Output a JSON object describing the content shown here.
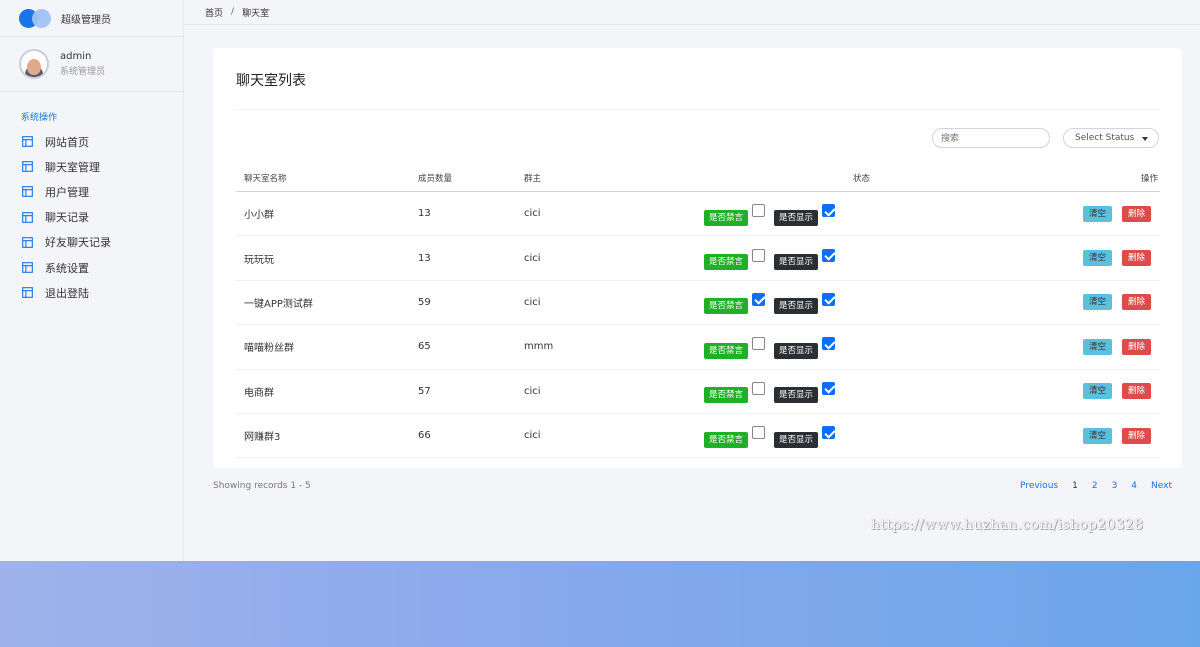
{
  "brand": {
    "title": "超级管理员"
  },
  "user": {
    "name": "admin",
    "role": "系统管理员"
  },
  "sidebar": {
    "section_title": "系统操作",
    "items": [
      {
        "label": "网站首页",
        "icon": "layout-icon"
      },
      {
        "label": "聊天室管理",
        "icon": "layout-icon"
      },
      {
        "label": "用户管理",
        "icon": "layout-icon"
      },
      {
        "label": "聊天记录",
        "icon": "layout-icon"
      },
      {
        "label": "好友聊天记录",
        "icon": "layout-icon"
      },
      {
        "label": "系统设置",
        "icon": "layout-icon"
      },
      {
        "label": "退出登陆",
        "icon": "layout-icon"
      }
    ]
  },
  "breadcrumb": {
    "home": "首页",
    "separator": "/",
    "current": "聊天室"
  },
  "card": {
    "title": "聊天室列表"
  },
  "filters": {
    "search_placeholder": "搜索",
    "status_select": "Select Status"
  },
  "table": {
    "headers": {
      "name": "聊天室名称",
      "members": "成员数量",
      "owner": "群主",
      "status": "状态",
      "ops": "操作"
    },
    "mute_label": "是否禁言",
    "show_label": "是否显示",
    "clear_label": "清空",
    "delete_label": "删除",
    "rows": [
      {
        "name": "小小群",
        "members": "13",
        "owner": "cici",
        "muted": false,
        "shown": true
      },
      {
        "name": "玩玩玩",
        "members": "13",
        "owner": "cici",
        "muted": false,
        "shown": true
      },
      {
        "name": "一键APP测试群",
        "members": "59",
        "owner": "cici",
        "muted": true,
        "shown": true
      },
      {
        "name": "喵喵粉丝群",
        "members": "65",
        "owner": "mmm",
        "muted": false,
        "shown": true
      },
      {
        "name": "电商群",
        "members": "57",
        "owner": "cici",
        "muted": false,
        "shown": true
      },
      {
        "name": "网赚群3",
        "members": "66",
        "owner": "cici",
        "muted": false,
        "shown": true
      }
    ]
  },
  "footer": {
    "records": "Showing records 1 - 5",
    "pagination": {
      "previous": "Previous",
      "pages": [
        "1",
        "2",
        "3",
        "4"
      ],
      "active": "1",
      "next": "Next"
    }
  },
  "watermark": "https://www.huzhan.com/ishop20328",
  "colors": {
    "accent": "#1a73e8",
    "success": "#20b027",
    "danger": "#dc4c4c",
    "info": "#5bc0de",
    "dark": "#2b2f33"
  }
}
